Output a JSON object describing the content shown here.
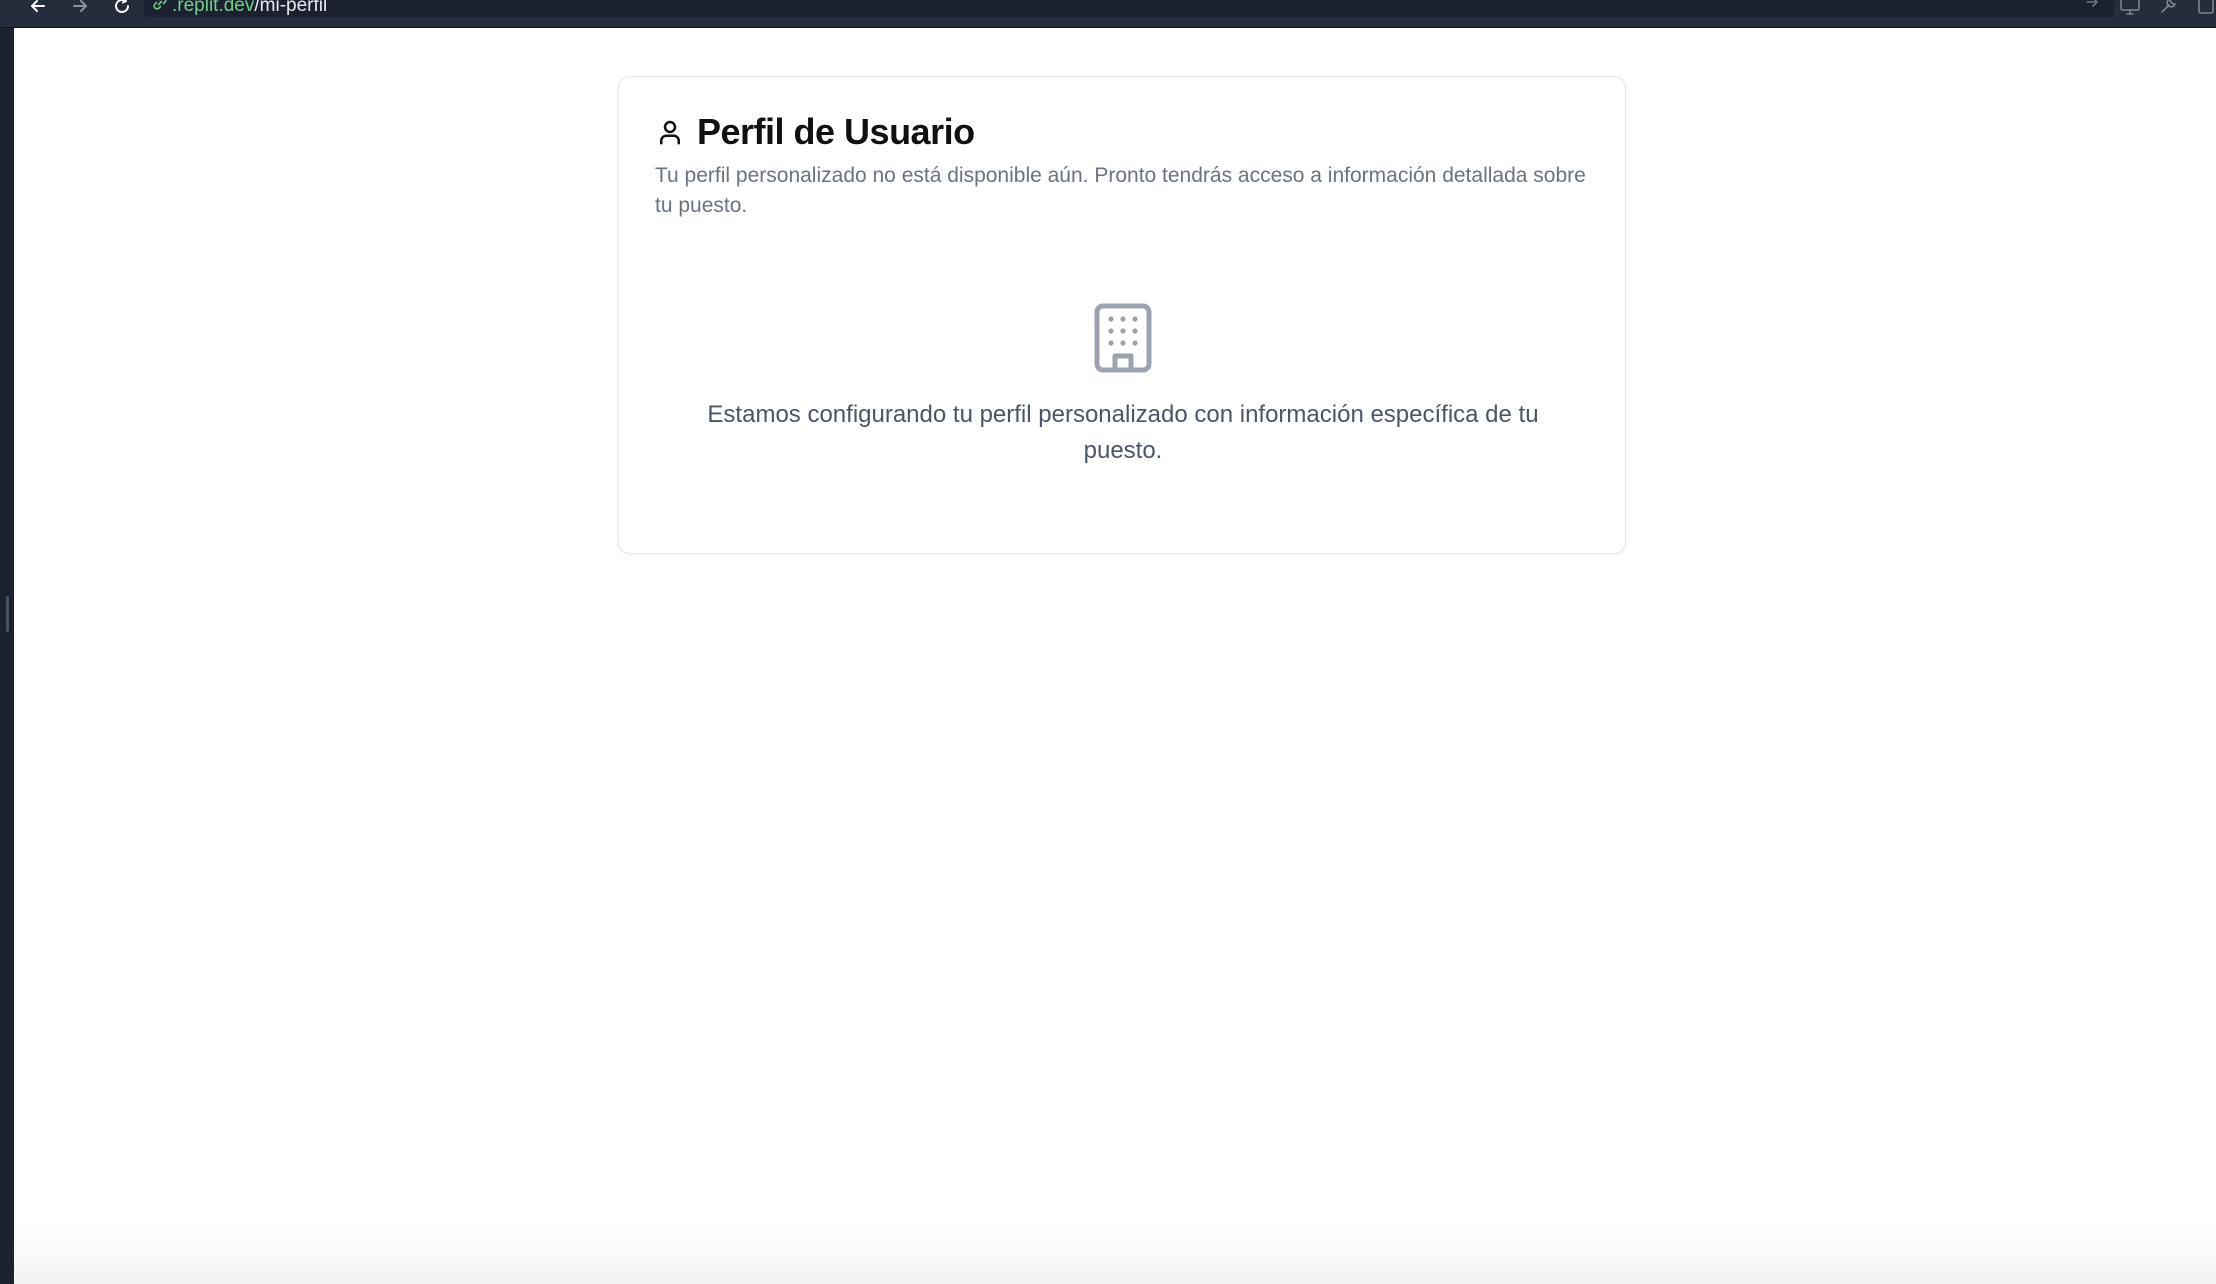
{
  "browser": {
    "url_domain": ".replit.dev",
    "url_path": "/mi-perfil"
  },
  "profile_card": {
    "title": "Perfil de Usuario",
    "description": "Tu perfil personalizado no está disponible aún. Pronto tendrás acceso a información detallada sobre tu puesto.",
    "message": "Estamos configurando tu perfil personalizado con información específica de tu puesto.",
    "title_icon": "user-icon",
    "status_icon": "building-icon"
  },
  "colors": {
    "toolbar_bg": "#252c3b",
    "url_domain": "#6fcf83",
    "card_border": "#e4e6ea",
    "icon_gray": "#9ca3af",
    "title_text": "#0f1115",
    "muted_text": "#6b7280"
  }
}
